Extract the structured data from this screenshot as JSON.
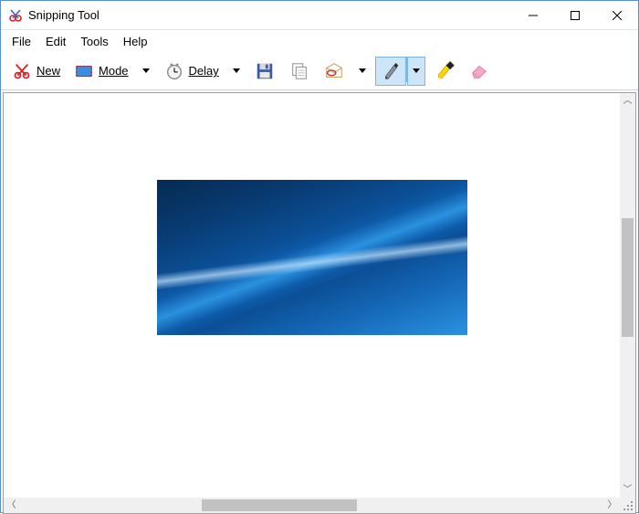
{
  "window": {
    "title": "Snipping Tool"
  },
  "menu": {
    "file": "File",
    "edit": "Edit",
    "tools": "Tools",
    "help": "Help"
  },
  "toolbar": {
    "new_label": "New",
    "mode_label": "Mode",
    "delay_label": "Delay"
  },
  "icons": {
    "app": "snipping-tool-icon",
    "new": "scissors-icon",
    "mode": "rectangle-mode-icon",
    "delay": "clock-icon",
    "save": "save-icon",
    "copy": "copy-icon",
    "send": "send-mail-icon",
    "pen": "pen-icon",
    "highlighter": "highlighter-icon",
    "eraser": "eraser-icon",
    "minimize": "minimize-icon",
    "maximize": "maximize-icon",
    "close": "close-icon"
  },
  "colors": {
    "selection_bg": "#cde6f7",
    "selection_border": "#7eb4ea"
  }
}
